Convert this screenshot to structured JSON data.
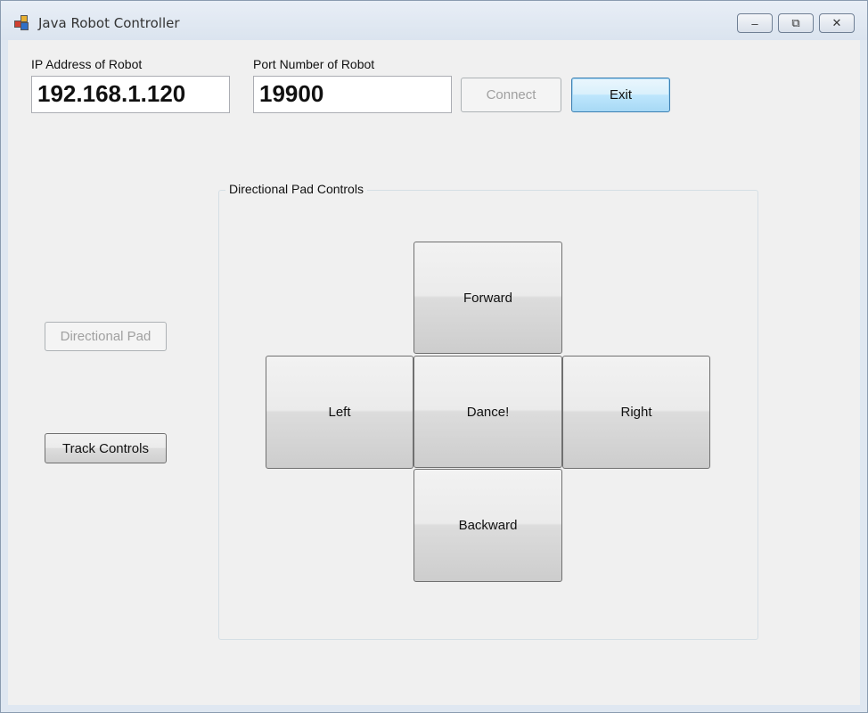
{
  "window": {
    "title": "Java Robot Controller",
    "minimize_glyph": "‒",
    "restore_glyph": "⧉",
    "close_glyph": "✕"
  },
  "connection": {
    "ip_label": "IP Address of Robot",
    "ip_value": "192.168.1.120",
    "port_label": "Port Number of Robot",
    "port_value": "19900",
    "connect_label": "Connect",
    "exit_label": "Exit"
  },
  "modes": {
    "directional_pad_label": "Directional Pad",
    "track_controls_label": "Track Controls"
  },
  "dpad": {
    "group_title": "Directional Pad Controls",
    "forward_label": "Forward",
    "left_label": "Left",
    "dance_label": "Dance!",
    "right_label": "Right",
    "backward_label": "Backward"
  }
}
